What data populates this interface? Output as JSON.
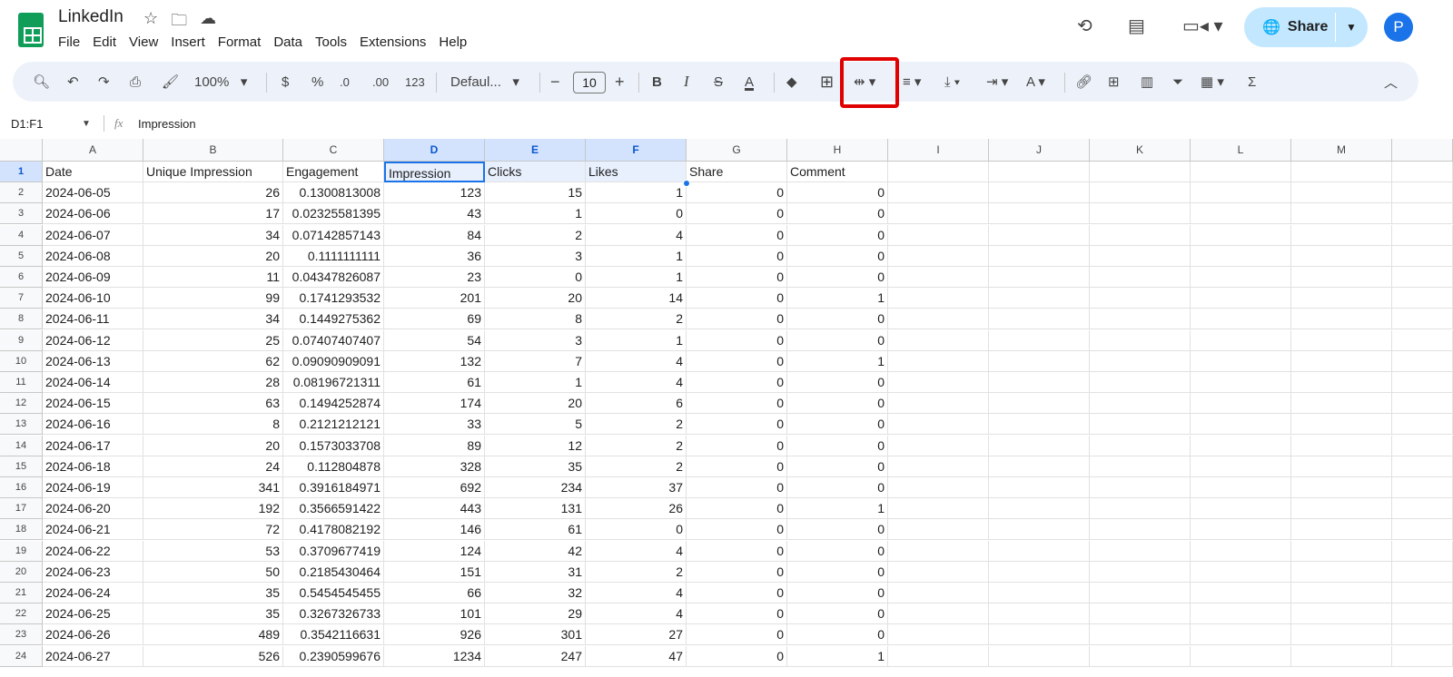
{
  "app": {
    "title": "LinkedIn",
    "menu": [
      "File",
      "Edit",
      "View",
      "Insert",
      "Format",
      "Data",
      "Tools",
      "Extensions",
      "Help"
    ],
    "share_label": "Share",
    "avatar_letter": "P"
  },
  "toolbar": {
    "zoom": "100%",
    "currency": "$",
    "percent": "%",
    "dec_decrease": ".0",
    "dec_increase": ".00",
    "format_more": "123",
    "font": "Defaul...",
    "font_size": "10",
    "bold": "B",
    "italic": "I",
    "highlighted_tool": "text-wrapping"
  },
  "formula_bar": {
    "name_box": "D1:F1",
    "fx": "fx",
    "content": "Impression"
  },
  "columns": [
    "A",
    "B",
    "C",
    "D",
    "E",
    "F",
    "G",
    "H",
    "I",
    "J",
    "K",
    "L",
    "M"
  ],
  "selected_columns": [
    "D",
    "E",
    "F"
  ],
  "headers": [
    "Date",
    "Unique Impression",
    "Engagement",
    "Impression",
    "Clicks",
    "Likes",
    "Share",
    "Comment"
  ],
  "rows": [
    [
      "2024-06-05",
      "26",
      "0.1300813008",
      "123",
      "15",
      "1",
      "0",
      "0"
    ],
    [
      "2024-06-06",
      "17",
      "0.02325581395",
      "43",
      "1",
      "0",
      "0",
      "0"
    ],
    [
      "2024-06-07",
      "34",
      "0.07142857143",
      "84",
      "2",
      "4",
      "0",
      "0"
    ],
    [
      "2024-06-08",
      "20",
      "0.1111111111",
      "36",
      "3",
      "1",
      "0",
      "0"
    ],
    [
      "2024-06-09",
      "11",
      "0.04347826087",
      "23",
      "0",
      "1",
      "0",
      "0"
    ],
    [
      "2024-06-10",
      "99",
      "0.1741293532",
      "201",
      "20",
      "14",
      "0",
      "1"
    ],
    [
      "2024-06-11",
      "34",
      "0.1449275362",
      "69",
      "8",
      "2",
      "0",
      "0"
    ],
    [
      "2024-06-12",
      "25",
      "0.07407407407",
      "54",
      "3",
      "1",
      "0",
      "0"
    ],
    [
      "2024-06-13",
      "62",
      "0.09090909091",
      "132",
      "7",
      "4",
      "0",
      "1"
    ],
    [
      "2024-06-14",
      "28",
      "0.08196721311",
      "61",
      "1",
      "4",
      "0",
      "0"
    ],
    [
      "2024-06-15",
      "63",
      "0.1494252874",
      "174",
      "20",
      "6",
      "0",
      "0"
    ],
    [
      "2024-06-16",
      "8",
      "0.2121212121",
      "33",
      "5",
      "2",
      "0",
      "0"
    ],
    [
      "2024-06-17",
      "20",
      "0.1573033708",
      "89",
      "12",
      "2",
      "0",
      "0"
    ],
    [
      "2024-06-18",
      "24",
      "0.112804878",
      "328",
      "35",
      "2",
      "0",
      "0"
    ],
    [
      "2024-06-19",
      "341",
      "0.3916184971",
      "692",
      "234",
      "37",
      "0",
      "0"
    ],
    [
      "2024-06-20",
      "192",
      "0.3566591422",
      "443",
      "131",
      "26",
      "0",
      "1"
    ],
    [
      "2024-06-21",
      "72",
      "0.4178082192",
      "146",
      "61",
      "0",
      "0",
      "0"
    ],
    [
      "2024-06-22",
      "53",
      "0.3709677419",
      "124",
      "42",
      "4",
      "0",
      "0"
    ],
    [
      "2024-06-23",
      "50",
      "0.2185430464",
      "151",
      "31",
      "2",
      "0",
      "0"
    ],
    [
      "2024-06-24",
      "35",
      "0.5454545455",
      "66",
      "32",
      "4",
      "0",
      "0"
    ],
    [
      "2024-06-25",
      "35",
      "0.3267326733",
      "101",
      "29",
      "4",
      "0",
      "0"
    ],
    [
      "2024-06-26",
      "489",
      "0.3542116631",
      "926",
      "301",
      "27",
      "0",
      "0"
    ],
    [
      "2024-06-27",
      "526",
      "0.2390599676",
      "1234",
      "247",
      "47",
      "0",
      "1"
    ]
  ]
}
